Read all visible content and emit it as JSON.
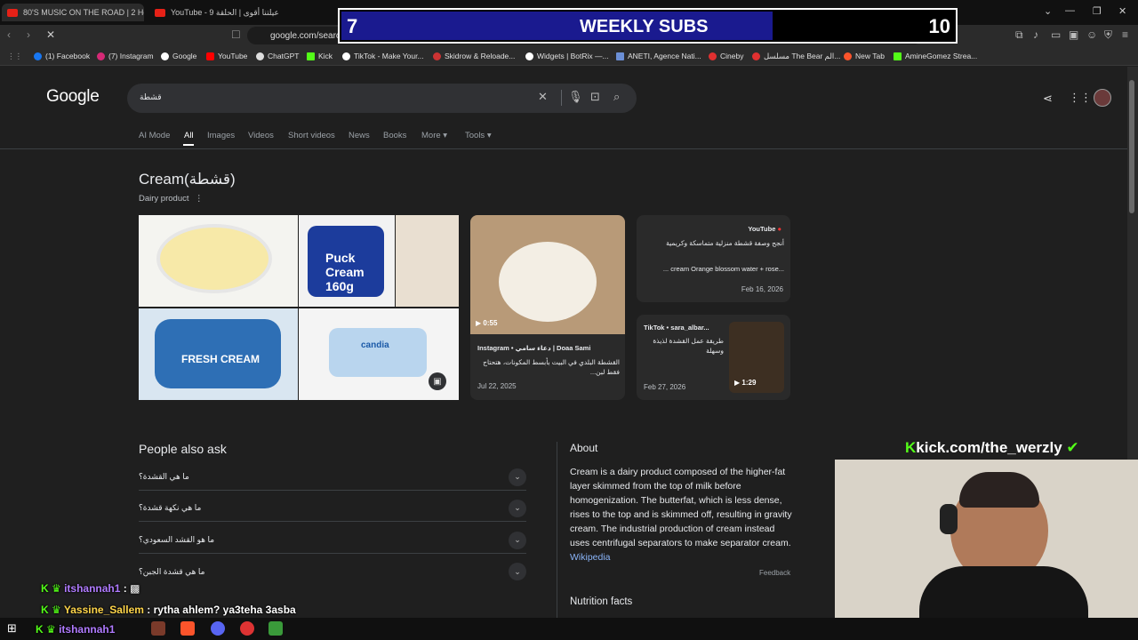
{
  "browser": {
    "tabs": [
      {
        "title": "80'S MUSIC ON THE ROAD | 2 Hours"
      },
      {
        "title": "YouTube - 9 عيلتنا أقوى | الحلقة"
      }
    ],
    "url": "google.com/search",
    "bookmarks": [
      {
        "label": "(1) Facebook",
        "color": "#1877f2"
      },
      {
        "label": "(7) Instagram",
        "color": "#d62976"
      },
      {
        "label": "Google",
        "color": "#ffffff"
      },
      {
        "label": "YouTube",
        "color": "#ff0000"
      },
      {
        "label": "ChatGPT",
        "color": "#dddddd"
      },
      {
        "label": "Kick",
        "color": "#53fc18"
      },
      {
        "label": "TikTok - Make Your...",
        "color": "#ffffff"
      },
      {
        "label": "Skidrow & Reloade...",
        "color": "#cc3333"
      },
      {
        "label": "Widgets | BotRix —...",
        "color": "#ffffff"
      },
      {
        "label": "ANETI, Agence Nati...",
        "color": "#6b8fd6"
      },
      {
        "label": "Cineby",
        "color": "#e03030"
      },
      {
        "label": "مسلسل The Bear الم...",
        "color": "#e03030"
      },
      {
        "label": "New Tab",
        "color": "#fb542b"
      },
      {
        "label": "AmineGomez Strea...",
        "color": "#53fc18"
      }
    ]
  },
  "overlay": {
    "subs_current": "7",
    "subs_title": "WEEKLY SUBS",
    "subs_goal": "10",
    "subs_progress": 0.7,
    "kick_url": "kick.com/the_werzly"
  },
  "google": {
    "logo": "Google",
    "query": "قشطة",
    "tabs": [
      "AI Mode",
      "All",
      "Images",
      "Videos",
      "Short videos",
      "News",
      "Books",
      "More",
      "Tools"
    ],
    "active_tab": "All",
    "title": "Cream(قشطة)",
    "subtitle": "Dairy product",
    "images": [
      "FRESH CREAM",
      "Puck Cream 160g",
      "candia"
    ],
    "cards": {
      "instagram": {
        "duration": "0:55",
        "source": "Instagram • دعاء سامي | Doaa Sami",
        "line1": "القشطة البلدي في البيت بأبسط المكونات، هتحتاج فقط لبن...",
        "date": "Jul 22, 2025"
      },
      "youtube": {
        "source": "YouTube",
        "line1": "أنجح وصفة قشطة منزلية متماسكة وكريمية",
        "line2": "... cream Orange blossom water + rose...",
        "date": "Feb 16, 2026"
      },
      "tiktok": {
        "source": "TikTok • sara_albar...",
        "line1": "طريقة عمل القشدة لذيذة وسهلة",
        "duration": "1:29",
        "date": "Feb 27, 2026"
      }
    },
    "paa_title": "People also ask",
    "questions": [
      "ما هي القشدة؟",
      "ما هي نكهة قشدة؟",
      "ما هو القشد السعودي؟",
      "ما هي قشدة الجبن؟"
    ],
    "about_title": "About",
    "about_text": "Cream is a dairy product composed of the higher-fat layer skimmed from the top of milk before homogenization. The butterfat, which is less dense, rises to the top and is skimmed off, resulting in gravity cream. The industrial production of cream instead uses centrifugal separators to make separator cream.",
    "about_link": "Wikipedia",
    "feedback": "Feedback",
    "nutrition": "Nutrition facts"
  },
  "chat": [
    {
      "user": "itshannah1",
      "msg": ""
    },
    {
      "user": "Yassine_Sallem",
      "msg": "rytha ahlem? ya3teha 3asba"
    },
    {
      "user": "itshannah1",
      "msg": ""
    }
  ]
}
